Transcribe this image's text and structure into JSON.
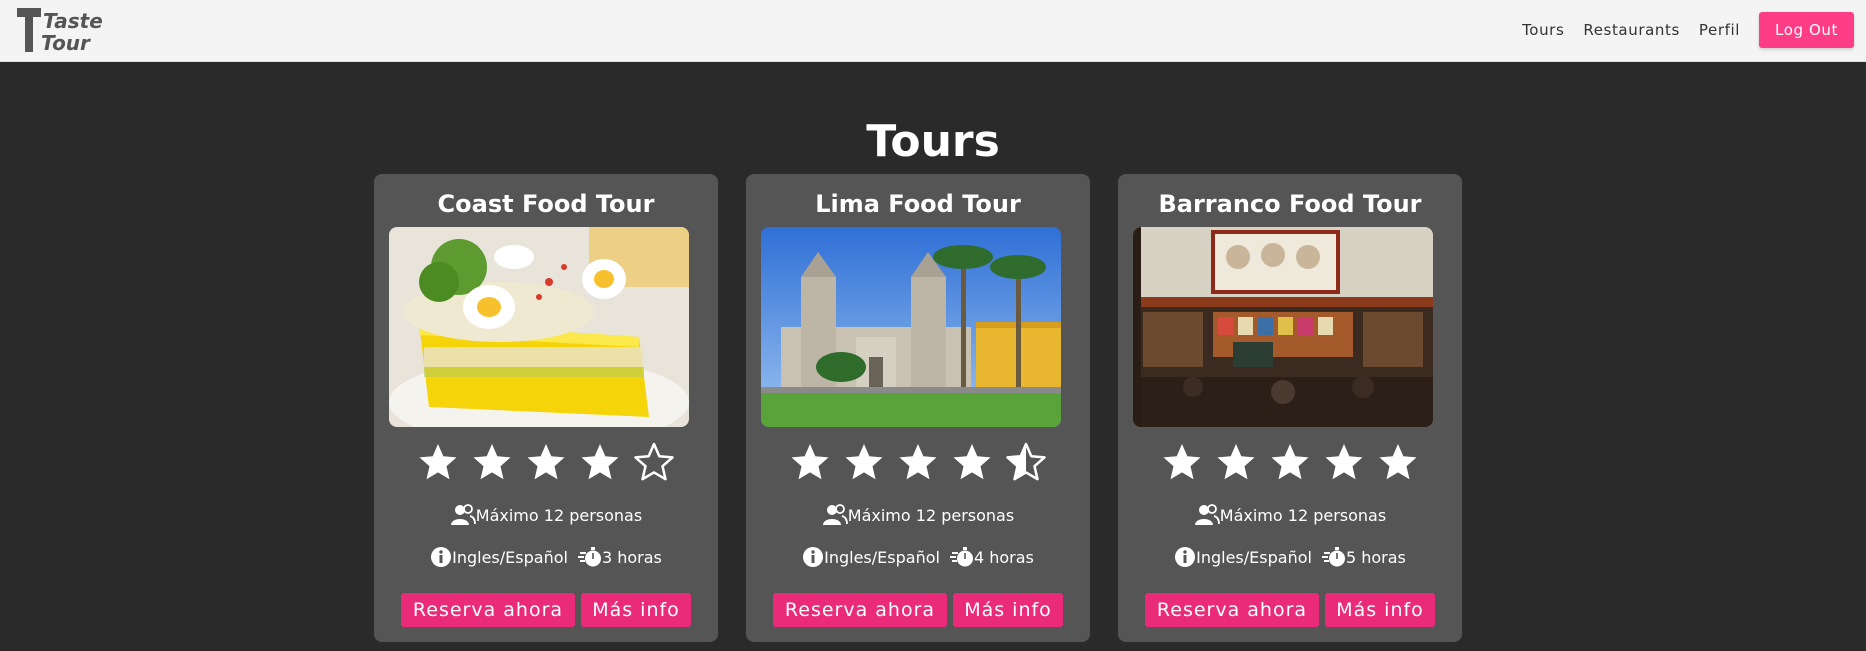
{
  "brand": {
    "logo_line1": "Taste",
    "logo_line2": "Tour"
  },
  "nav": {
    "links": [
      "Tours",
      "Restaurants",
      "Perfil"
    ],
    "logout_label": "Log Out"
  },
  "section_title": "Tours",
  "tours": [
    {
      "title": "Coast Food Tour",
      "image": "causa-dish-photo",
      "rating": 4,
      "capacity": "Máximo 12 personas",
      "language": "Ingles/Español",
      "duration": "3 horas",
      "reserve_label": "Reserva ahora",
      "info_label": "Más info"
    },
    {
      "title": "Lima Food Tour",
      "image": "lima-cathedral-photo",
      "rating": 4.5,
      "capacity": "Máximo 12 personas",
      "language": "Ingles/Español",
      "duration": "4 horas",
      "reserve_label": "Reserva ahora",
      "info_label": "Más info"
    },
    {
      "title": "Barranco Food Tour",
      "image": "barranco-bar-photo",
      "rating": 5,
      "capacity": "Máximo 12 personas",
      "language": "Ingles/Español",
      "duration": "5 horas",
      "reserve_label": "Reserva ahora",
      "info_label": "Más info"
    }
  ],
  "colors": {
    "page_bg": "#2a2a2a",
    "card_bg": "#555555",
    "button_pink": "#ea2b79",
    "logout_pink": "#ff3d86",
    "navbar_bg": "#f4f4f4"
  },
  "icons": [
    "users-icon",
    "info-circle-icon",
    "stopwatch-icon",
    "star-icon",
    "star-half-icon",
    "star-outline-icon"
  ]
}
